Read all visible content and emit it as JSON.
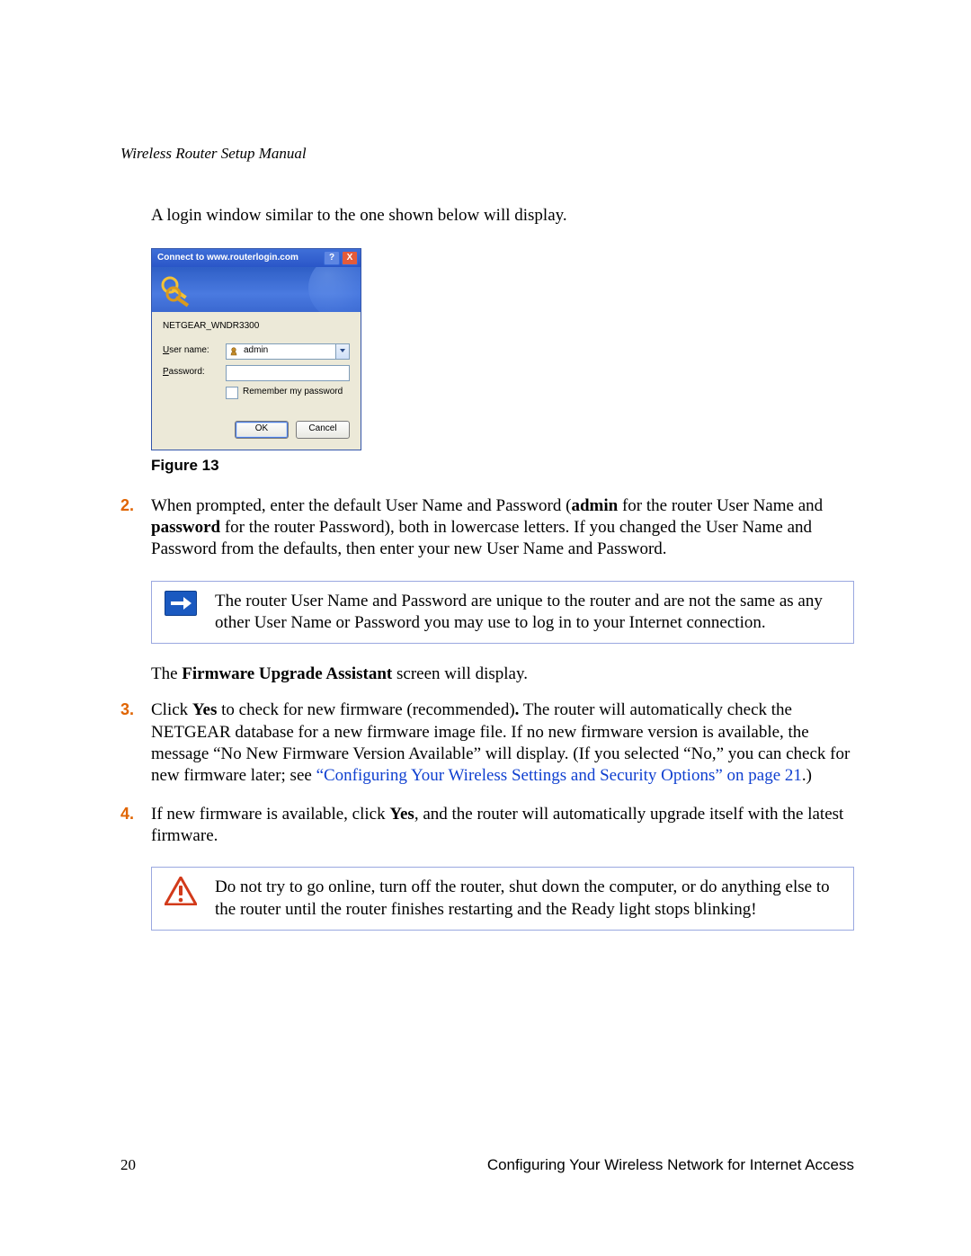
{
  "running_head": "Wireless Router Setup Manual",
  "intro_para": "A login window similar to the one shown below will display.",
  "login_dialog": {
    "title": "Connect to www.routerlogin.com",
    "help_caption": "?",
    "close_caption": "X",
    "server_name": "NETGEAR_WNDR3300",
    "username_label_pre": "U",
    "username_label_rest": "ser name:",
    "username_value": "admin",
    "password_label_pre": "P",
    "password_label_rest": "assword:",
    "password_value": "",
    "remember_label_pre": "R",
    "remember_label_rest": "emember my password",
    "ok_label": "OK",
    "cancel_label": "Cancel"
  },
  "figure_caption": "Figure 13",
  "step2": {
    "num": "2.",
    "pre": "When prompted, enter the default User Name and Password (",
    "bold1": "admin",
    "mid1": " for the router User Name and ",
    "bold2": "password",
    "rest": " for the router Password), both in lowercase letters. If you changed the User Name and Password from the defaults, then enter your new User Name and Password."
  },
  "note1": "The router User Name and Password are unique to the router and are not the same as any other User Name or Password you may use to log in to your Internet connection.",
  "fw_para_pre": "The ",
  "fw_para_bold": "Firmware Upgrade Assistant",
  "fw_para_post": " screen will display.",
  "step3": {
    "num": "3.",
    "pre": "Click ",
    "bold1": "Yes",
    "mid1": " to check for new firmware (recommended)",
    "boldstop": ".",
    "mid2": " The router will automatically check the NETGEAR database for a new firmware image file. If no new firmware version is available, the message “No New Firmware Version Available” will display. (If you selected “No,” you can check for new firmware later; see ",
    "link": "“Configuring Your Wireless Settings and Security Options” on page 21",
    "post": ".)"
  },
  "step4": {
    "num": "4.",
    "pre": "If new firmware is available, click ",
    "bold1": "Yes",
    "post": ", and the router will automatically upgrade itself with the latest firmware."
  },
  "warning": "Do not try to go online, turn off the router, shut down the computer, or do anything else to the router until the router finishes restarting and the Ready light stops blinking!",
  "footer": {
    "page_number": "20",
    "section": "Configuring Your Wireless Network for Internet Access"
  }
}
